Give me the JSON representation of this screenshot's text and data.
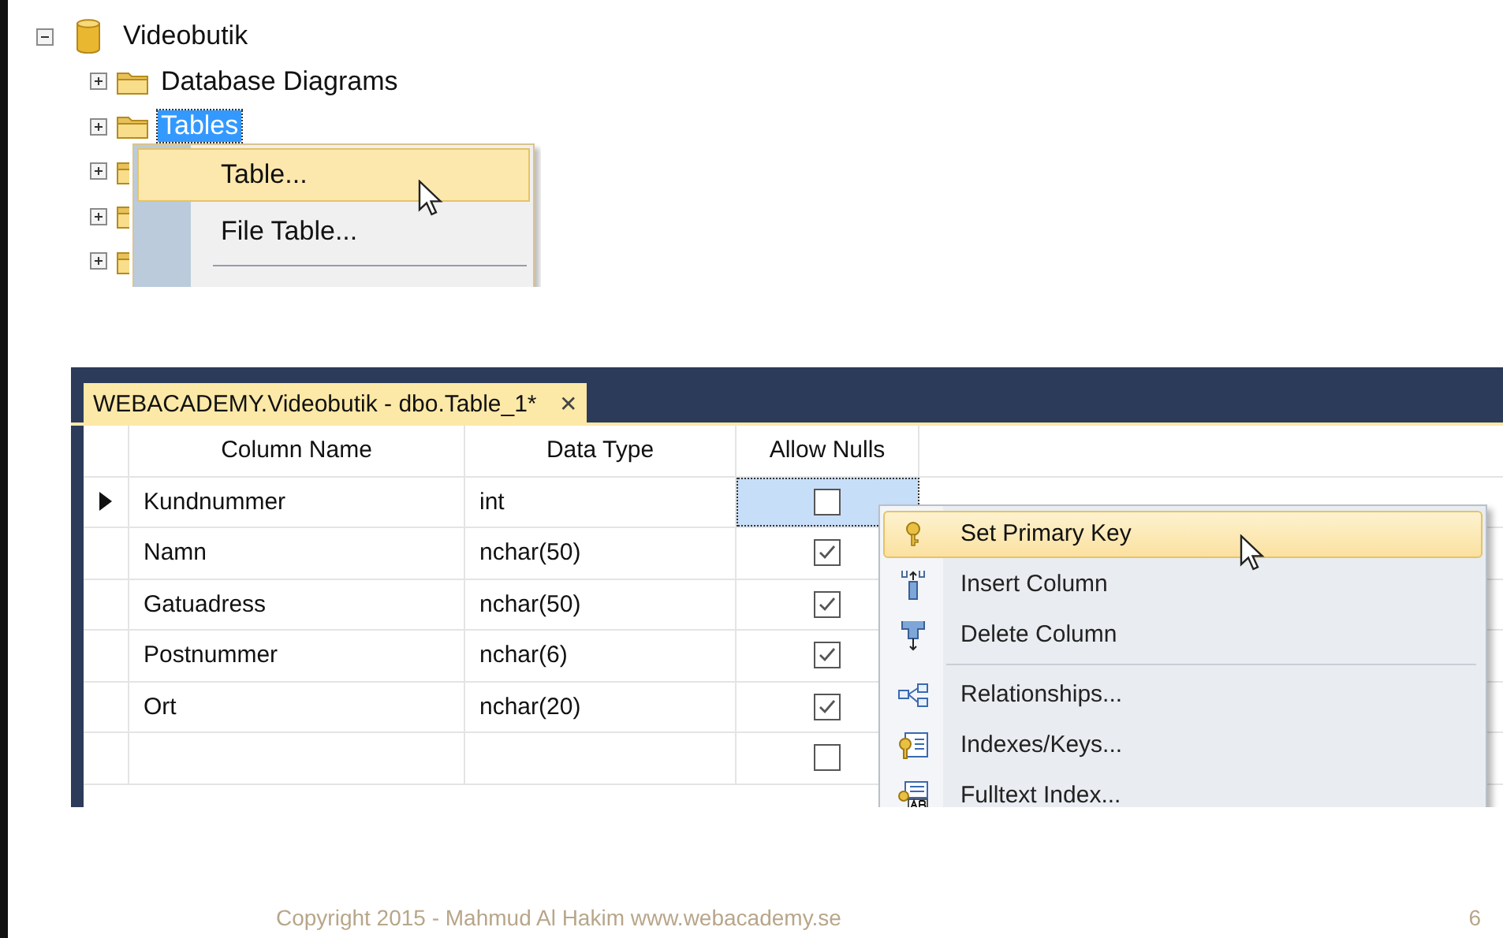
{
  "object_explorer": {
    "tree": [
      {
        "label": "Videobutik",
        "kind": "database",
        "expanded": true,
        "selected": false,
        "children": [
          {
            "label": "Database Diagrams",
            "kind": "folder",
            "expanded": false,
            "selected": false
          },
          {
            "label": "Tables",
            "kind": "folder",
            "expanded": false,
            "selected": true
          },
          {
            "kind": "folder",
            "expanded": false
          },
          {
            "kind": "folder",
            "expanded": false
          },
          {
            "kind": "folder",
            "expanded": false
          }
        ]
      }
    ],
    "context_menu": [
      {
        "label": "Table...",
        "selected": true
      },
      {
        "label": "File Table...",
        "selected": false
      }
    ]
  },
  "designer": {
    "tab": {
      "title": "WEBACADEMY.Videobutik - dbo.Table_1*",
      "close": "✕"
    },
    "columns": [
      "Column Name",
      "Data Type",
      "Allow Nulls"
    ],
    "rows": [
      {
        "name": "Kundnummer",
        "type": "int",
        "checked": false,
        "selected": true
      },
      {
        "name": "Namn",
        "type": "nchar(50)",
        "checked": true,
        "selected": false
      },
      {
        "name": "Gatuadress",
        "type": "nchar(50)",
        "checked": true,
        "selected": false
      },
      {
        "name": "Postnummer",
        "type": "nchar(6)",
        "checked": true,
        "selected": false
      },
      {
        "name": "Ort",
        "type": "nchar(20)",
        "checked": true,
        "selected": false
      },
      {
        "checked": false,
        "selected": false
      }
    ],
    "context_menu": [
      {
        "kind": "key",
        "label": "Set Primary Key",
        "selected": true
      },
      {
        "kind": "insert",
        "label": "Insert Column",
        "selected": false
      },
      {
        "kind": "delete",
        "label": "Delete Column",
        "selected": false
      },
      {
        "kind": "separator"
      },
      {
        "kind": "relationships",
        "label": "Relationships...",
        "selected": false
      },
      {
        "kind": "indexes",
        "label": "Indexes/Keys...",
        "selected": false
      },
      {
        "kind": "fulltext",
        "label": "Fulltext Index...",
        "selected": false
      }
    ]
  },
  "footer": {
    "copyright": "Copyright 2015 - Mahmud Al Hakim www.webacademy.se",
    "page_number": "6"
  }
}
